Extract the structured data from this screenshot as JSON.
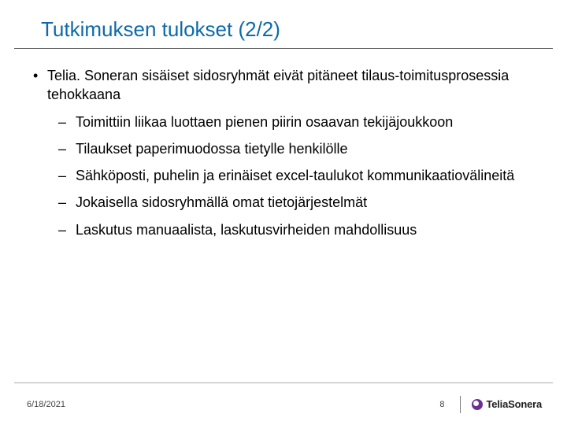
{
  "slide": {
    "title": "Tutkimuksen tulokset (2/2)",
    "main_bullet": "Telia. Soneran sisäiset sidosryhmät eivät pitäneet tilaus-toimitusprosessia tehokkaana",
    "sub_bullets": [
      "Toimittiin liikaa luottaen pienen piirin osaavan tekijäjoukkoon",
      "Tilaukset paperimuodossa tietylle henkilölle",
      "Sähköposti, puhelin ja erinäiset excel-taulukot kommunikaatiovälineitä",
      "Jokaisella sidosryhmällä omat tietojärjestelmät",
      "Laskutus manuaalista, laskutusvirheiden mahdollisuus"
    ]
  },
  "footer": {
    "date": "6/18/2021",
    "page": "8",
    "logo_text": "TeliaSonera"
  }
}
